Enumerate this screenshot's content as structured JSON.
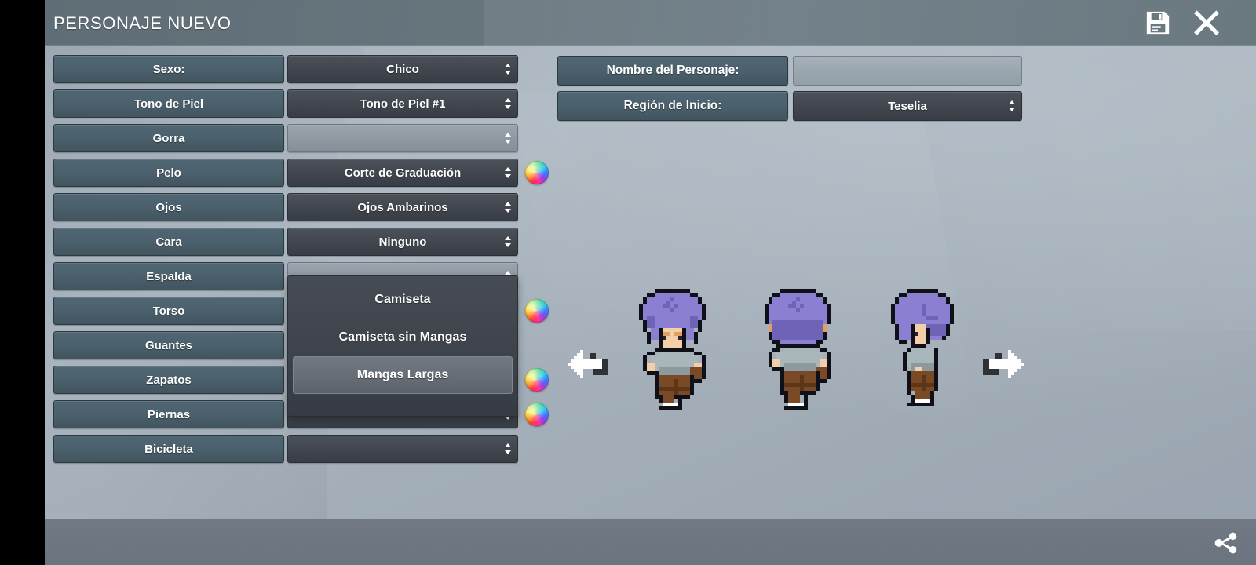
{
  "window": {
    "title": "PERSONAJE NUEVO",
    "save_icon": "floppy-disk-save-icon",
    "close_icon": "close-x-icon"
  },
  "colors": {
    "background": "#a6b2bc",
    "titlebar": "#6a7880",
    "label_button": "#4b616d",
    "combo": "#434850",
    "combo_empty": "#9ba5ad",
    "combo_active": "#56657a",
    "text": "#ffffff"
  },
  "form": {
    "rows": [
      {
        "label": "Sexo:",
        "value": "Chico",
        "empty": false,
        "color_wheel": false,
        "active": false
      },
      {
        "label": "Tono de Piel",
        "value": "Tono de Piel #1",
        "empty": false,
        "color_wheel": false,
        "active": false
      },
      {
        "label": "Gorra",
        "value": "",
        "empty": true,
        "color_wheel": false,
        "active": false
      },
      {
        "label": "Pelo",
        "value": "Corte de Graduación",
        "empty": false,
        "color_wheel": true,
        "active": false
      },
      {
        "label": "Ojos",
        "value": "Ojos Ambarinos",
        "empty": false,
        "color_wheel": false,
        "active": false
      },
      {
        "label": "Cara",
        "value": "Ninguno",
        "empty": false,
        "color_wheel": false,
        "active": false
      },
      {
        "label": "Espalda",
        "value": "",
        "empty": true,
        "color_wheel": false,
        "active": false
      },
      {
        "label": "Torso",
        "value": "Mangas Largas",
        "empty": false,
        "color_wheel": true,
        "active": true
      },
      {
        "label": "Guantes",
        "value": "",
        "empty": false,
        "color_wheel": false,
        "active": false
      },
      {
        "label": "Zapatos",
        "value": "",
        "empty": false,
        "color_wheel": true,
        "active": false
      },
      {
        "label": "Piernas",
        "value": "",
        "empty": false,
        "color_wheel": true,
        "active": false
      },
      {
        "label": "Bicicleta",
        "value": "",
        "empty": false,
        "color_wheel": false,
        "active": false
      }
    ]
  },
  "dropdown": {
    "open_for": "Torso",
    "options": [
      {
        "label": "Camiseta",
        "selected": false
      },
      {
        "label": "Camiseta sin Mangas",
        "selected": false
      },
      {
        "label": "Mangas Largas",
        "selected": true
      }
    ]
  },
  "right_panel": {
    "name_label": "Nombre del Personaje:",
    "name_value": "",
    "name_placeholder": "",
    "region_label": "Región de Inicio:",
    "region_value": "Teselia"
  },
  "preview": {
    "prev_arrow_icon": "arrow-left-icon",
    "next_arrow_icon": "arrow-right-icon",
    "sprites": [
      {
        "name": "sprite-front",
        "view": "front"
      },
      {
        "name": "sprite-back",
        "view": "back"
      },
      {
        "name": "sprite-side",
        "view": "side"
      }
    ],
    "palette": {
      "hair": "#8a7fd0",
      "hair_dark": "#6f63b8",
      "skin": "#f2cfa8",
      "shirt": "#a9b7bb",
      "pants": "#7a4a27",
      "outline": "#101018"
    }
  },
  "bottom_bar": {
    "share_icon": "share-nodes-icon"
  }
}
